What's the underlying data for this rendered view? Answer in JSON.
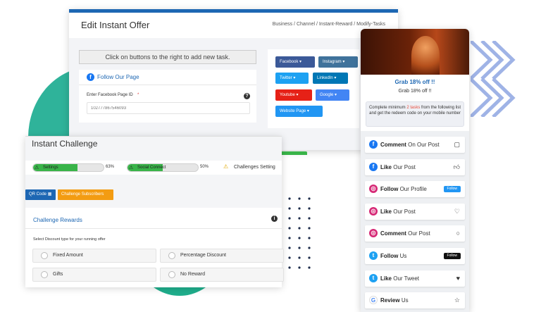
{
  "edit_offer": {
    "title": "Edit Instant Offer",
    "breadcrumb": "Business / Channel / Instant-Reward / Modify-Tasks",
    "hint": "Click on buttons to the right to add new task.",
    "fb_section_title": "Follow Our Page",
    "fb_field_label": "Enter Facebook Page ID",
    "fb_required_mark": "*",
    "fb_field_placeholder": "102777867546093",
    "social_buttons": [
      {
        "label": "Facebook",
        "color": "#3b5998"
      },
      {
        "label": "Instagram",
        "color": "#3f729b"
      },
      {
        "label": "Twitter",
        "color": "#1da1f2"
      },
      {
        "label": "LinkedIn",
        "color": "#0077b5"
      },
      {
        "label": "Youtube",
        "color": "#e62117"
      },
      {
        "label": "Google",
        "color": "#4285f4"
      },
      {
        "label": "Website Page",
        "color": "#2196f3"
      }
    ]
  },
  "challenge": {
    "title": "Instant Challenge",
    "steps": [
      {
        "label": "Settings",
        "percent": 63,
        "percent_text": "63%"
      },
      {
        "label": "Social Connect",
        "percent": 50,
        "percent_text": "50%"
      },
      {
        "label": "Challenges Setting"
      }
    ],
    "qr_button": "QR Code",
    "subscribers_button": "Challenge Subscribers",
    "rewards_title": "Challenge Rewards",
    "rewards_instruction": "Select Discount type for your running offer",
    "options": [
      "Fixed Amount",
      "Percentage Discount",
      "Gifts",
      "No Reward"
    ]
  },
  "phone": {
    "headline": "Grab 18% off !!",
    "subheadline": "Grab 18% off !!",
    "info_pre": "Complete minimum",
    "info_highlight": "2 tasks",
    "info_post": "from the following list and get the redeem code on your mobile number",
    "tasks": [
      {
        "bold": "Comment",
        "rest": "On Our Post",
        "icon": "facebook-icon"
      },
      {
        "bold": "Like",
        "rest": "Our Post",
        "icon": "facebook-icon"
      },
      {
        "bold": "Follow",
        "rest": "Our Profile",
        "icon": "instagram-icon",
        "pill": "Follow"
      },
      {
        "bold": "Like",
        "rest": "Our Post",
        "icon": "instagram-icon"
      },
      {
        "bold": "Comment",
        "rest": "Our Post",
        "icon": "instagram-icon"
      },
      {
        "bold": "Follow",
        "rest": "Us",
        "icon": "twitter-icon",
        "pill": "Follow"
      },
      {
        "bold": "Like",
        "rest": "Our Tweet",
        "icon": "twitter-icon"
      },
      {
        "bold": "Review",
        "rest": "Us",
        "icon": "google-icon"
      }
    ],
    "accent": "#1d67b3"
  }
}
